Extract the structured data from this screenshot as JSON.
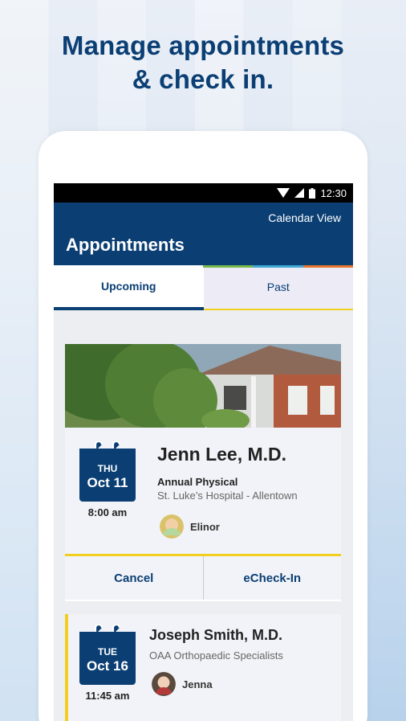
{
  "promo": {
    "line1": "Manage appointments",
    "line2": "& check in."
  },
  "statusbar": {
    "time": "12:30"
  },
  "appbar": {
    "calendar_view": "Calendar View",
    "title": "Appointments"
  },
  "tabs": [
    {
      "label": "Upcoming",
      "active": true
    },
    {
      "label": "Past",
      "active": false
    }
  ],
  "appointments": [
    {
      "day": "THU",
      "date": "Oct 11",
      "time": "8:00 am",
      "doctor": "Jenn Lee, M.D.",
      "type": "Annual Physical",
      "location": "St. Luke’s Hospital - Allentown",
      "patient": "Elinor"
    },
    {
      "day": "TUE",
      "date": "Oct 16",
      "time": "11:45 am",
      "doctor": "Joseph Smith, M.D.",
      "location": "OAA Orthopaedic Specialists",
      "patient": "Jenna"
    }
  ],
  "actions": {
    "cancel": "Cancel",
    "echeckin": "eCheck-In"
  },
  "colors": {
    "brand_navy": "#0b3f74",
    "accent_yellow": "#f2cf1f"
  }
}
